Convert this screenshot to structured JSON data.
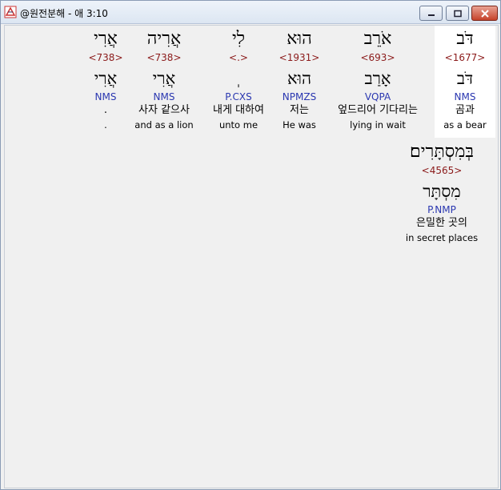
{
  "window": {
    "title": "@원전분해 - 애 3:10"
  },
  "colors": {
    "strong": "#8b1a1a",
    "morph": "#2a37b0",
    "highlight": "#ffffff"
  },
  "words": [
    {
      "hebrew": "דֹּב",
      "strong": "<1677>",
      "lemma": "דֹּב",
      "morph": "NMS",
      "korean": "곰과",
      "english": "as a bear"
    },
    {
      "hebrew": "אֹרֵב",
      "strong": "<693>",
      "lemma": "אָרַב",
      "morph": "VQPA",
      "korean": "엎드리어 기다리는",
      "english": "lying in wait"
    },
    {
      "hebrew": "הוּא",
      "strong": "<1931>",
      "lemma": "הוּא",
      "morph": "NPMZS",
      "korean": "저는",
      "english": "He was"
    },
    {
      "hebrew": "לִי",
      "strong": "<.>",
      "lemma": "ְ",
      "morph": "P.CXS",
      "korean": "내게 대하여",
      "english": "unto me"
    },
    {
      "hebrew": "אֲרִיה",
      "strong": "<738>",
      "lemma": "אֲרִי",
      "morph": "NMS",
      "korean": "사자 같으사",
      "english": "and as a lion"
    },
    {
      "hebrew": "אֲרִי",
      "strong": "<738>",
      "lemma": "אֲרִי",
      "morph": "NMS",
      "korean": ".",
      "english": "."
    },
    {
      "hebrew": "בְּמִסְתָּרִים׃",
      "strong": "<4565>",
      "lemma": "מִסְתָּר",
      "morph": "P.NMP",
      "korean": "은밀한 곳의",
      "english": "in secret places"
    }
  ]
}
